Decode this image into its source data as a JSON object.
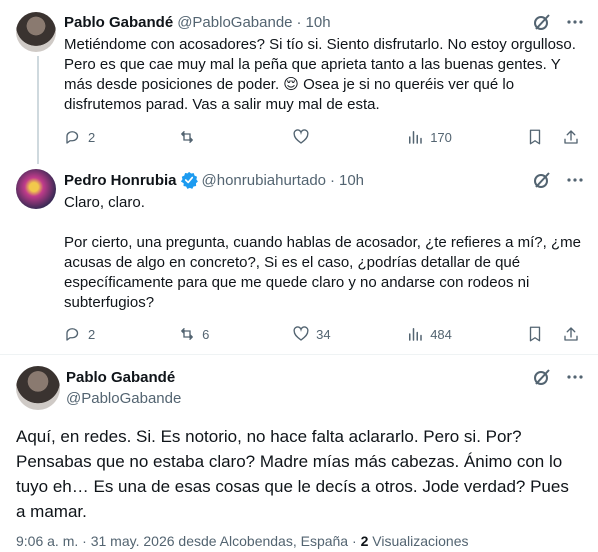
{
  "tweet1": {
    "name": "Pablo Gabandé",
    "handle": "@PabloGabande",
    "dot": "·",
    "time": "10h",
    "text": "Metiéndome con acosadores? Si tío si. Siento disfrutarlo. No estoy orgulloso. Pero es que cae muy mal la peña que aprieta tanto a las buenas gentes. Y más desde posiciones de poder. 😌 Osea je si no queréis ver qué lo disfrutemos parad. Vas a salir muy mal de esta.",
    "replies": "2",
    "retweets": "",
    "likes": "",
    "views": "170"
  },
  "tweet2": {
    "name": "Pedro Honrubia",
    "handle": "@honrubiahurtado",
    "dot": "·",
    "time": "10h",
    "text": "Claro, claro.\n\nPor cierto, una pregunta, cuando hablas de acosador, ¿te refieres a mí?, ¿me acusas de algo en concreto?, Si es el caso, ¿podrías detallar de qué específicamente para que me quede claro y no andarse con rodeos ni subterfugios?",
    "replies": "2",
    "retweets": "6",
    "likes": "34",
    "views": "484"
  },
  "main": {
    "name": "Pablo Gabandé",
    "handle": "@PabloGabande",
    "text": "Aquí, en redes. Si. Es notorio, no hace falta aclararlo. Pero si. Por? Pensabas que no estaba claro? Madre mías más cabezas. Ánimo con lo tuyo eh… Es una de esas cosas que le decís a otros. Jode verdad? Pues a mamar.",
    "time": "9:06 a. m.",
    "date": "31 may. 2026",
    "location": "desde Alcobendas, España",
    "views_count": "2",
    "views_label": "Visualizaciones"
  },
  "icons": {
    "grok": "grok-icon",
    "more": "more-icon",
    "reply": "reply-icon",
    "retweet": "retweet-icon",
    "like": "like-icon",
    "views": "views-icon",
    "bookmark": "bookmark-icon",
    "share": "share-icon",
    "verified": "verified-badge-icon"
  },
  "colors": {
    "text": "#0f1419",
    "secondary": "#536471",
    "verified": "#1d9bf0",
    "divider": "#eff3f4"
  }
}
